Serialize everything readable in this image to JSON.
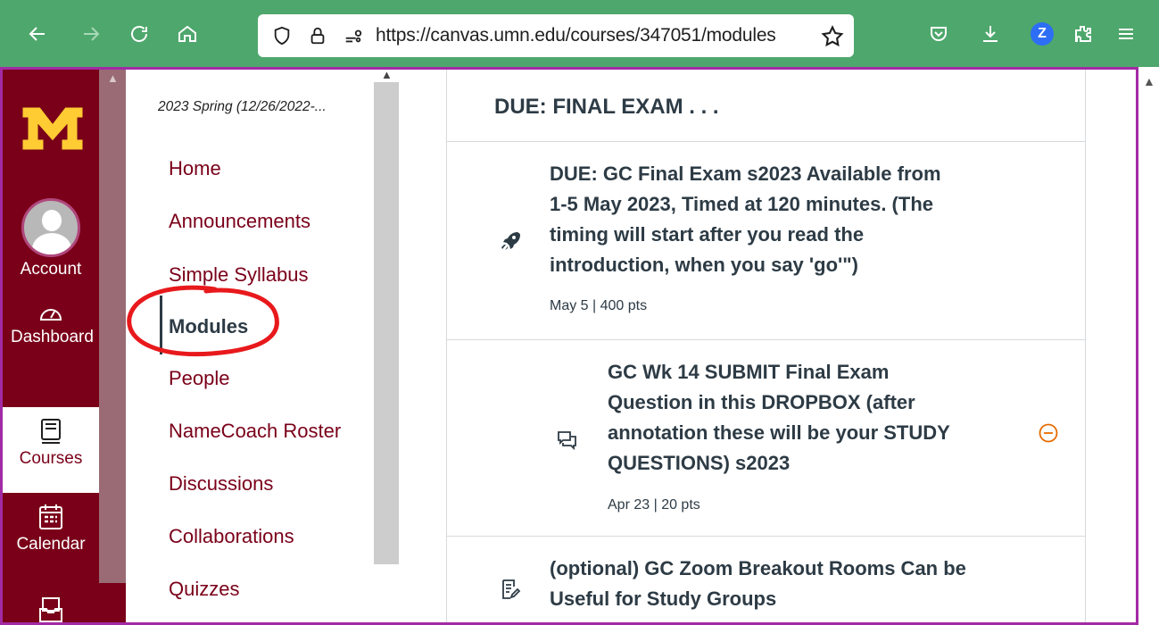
{
  "browser": {
    "url": "https://canvas.umn.edu/courses/347051/modules",
    "profile_badge": "Z"
  },
  "global_nav": {
    "account_label": "Account",
    "dashboard_label": "Dashboard",
    "courses_label": "Courses",
    "calendar_label": "Calendar"
  },
  "course_nav": {
    "term": "2023 Spring (12/26/2022-...",
    "links": [
      "Home",
      "Announcements",
      "Simple Syllabus",
      "Modules",
      "People",
      "NameCoach Roster",
      "Discussions",
      "Collaborations",
      "Quizzes"
    ],
    "active": "Modules"
  },
  "module": {
    "title": "DUE: FINAL EXAM . . .",
    "items": [
      {
        "title_lines": [
          "DUE: GC Final Exam s2023 Available from",
          "1-5 May 2023, Timed at 120 minutes. (The",
          "timing will start after you read the",
          "introduction, when you say 'go'\")"
        ],
        "meta": "May 5  |  400 pts",
        "icon": "rocket-icon"
      },
      {
        "title_lines": [
          "GC Wk 14 SUBMIT Final Exam",
          "Question in this DROPBOX (after",
          "annotation these will be your STUDY",
          "QUESTIONS) s2023"
        ],
        "meta": "Apr 23  |  20 pts",
        "icon": "discussion-icon"
      },
      {
        "title_lines": [
          "(optional) GC Zoom Breakout Rooms Can be",
          "Useful for Study Groups"
        ],
        "meta": "",
        "icon": "page-edit-icon"
      }
    ]
  },
  "colors": {
    "toolbar": "#4ea76c",
    "maroon": "#7a0019",
    "gold": "#ffcc33",
    "annotation": "#e8191c",
    "frame": "#a22aa5"
  }
}
